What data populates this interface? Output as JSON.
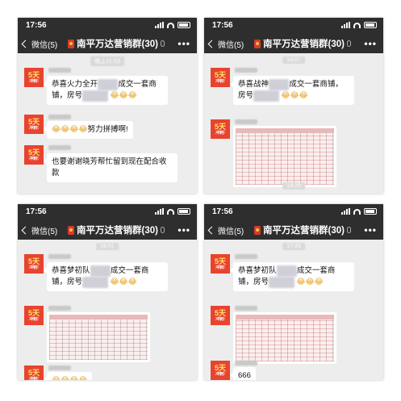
{
  "status_time": "17:56",
  "nav": {
    "back_label": "微信(5)",
    "group_title": "南平万达营销群(30)",
    "more_label": "•••"
  },
  "avatar": {
    "big": "5天",
    "small": "冲刺!"
  },
  "emoji_glyph": "😂",
  "colors": {
    "header": "#2e2e2e",
    "chat_bg": "#ededed",
    "bubble": "#ffffff",
    "avatar": "#e8432e"
  },
  "panes": [
    {
      "messages": [
        {
          "type": "text",
          "parts": [
            "恭喜火力全开",
            "成交一套商铺，房号",
            ""
          ],
          "emoji_count": 3
        },
        {
          "type": "text",
          "parts": [
            "努力拼搏啊!"
          ],
          "emoji_count": 4
        },
        {
          "type": "text",
          "parts": [
            "也要谢谢晓芳帮忙留到现在配合收款"
          ]
        }
      ]
    },
    {
      "messages": [
        {
          "type": "text",
          "parts": [
            "恭喜战神",
            "成交一套商铺，房号",
            ""
          ],
          "emoji_count": 3
        },
        {
          "type": "image"
        }
      ]
    },
    {
      "messages": [
        {
          "type": "text",
          "parts": [
            "恭喜梦初队",
            "成交一套商铺，房号",
            ""
          ],
          "emoji_count": 3
        },
        {
          "type": "image"
        },
        {
          "type": "emoji",
          "emoji_count": 4
        }
      ]
    },
    {
      "messages": [
        {
          "type": "text",
          "parts": [
            "恭喜梦初队",
            "成交一套商铺，房号",
            ""
          ],
          "emoji_count": 3
        },
        {
          "type": "image"
        },
        {
          "type": "text",
          "parts": [
            "666"
          ]
        }
      ]
    }
  ]
}
